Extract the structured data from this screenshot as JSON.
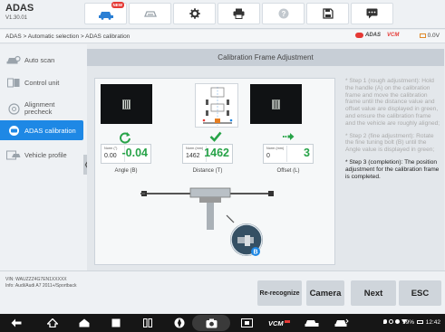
{
  "app": {
    "title": "ADAS",
    "version": "V1.30.01"
  },
  "top_buttons": [
    {
      "name": "home-car-icon",
      "badge": "NEW"
    },
    {
      "name": "vehicle-tools-icon"
    },
    {
      "name": "settings-gear-icon"
    },
    {
      "name": "printer-icon"
    },
    {
      "name": "help-icon"
    },
    {
      "name": "save-icon"
    },
    {
      "name": "chat-icon"
    }
  ],
  "breadcrumb": "ADAS > Automatic selection > ADAS calibration",
  "brand_logos": [
    "ADAS",
    "VCM"
  ],
  "voltage": "0.0V",
  "sidebar": {
    "items": [
      {
        "label": "Auto scan",
        "icon": "car-search-icon"
      },
      {
        "label": "Control unit",
        "icon": "control-unit-icon"
      },
      {
        "label": "Alignment precheck",
        "icon": "wheel-icon"
      },
      {
        "label": "ADAS calibration",
        "icon": "calibration-icon"
      },
      {
        "label": "Vehicle profile",
        "icon": "vehicle-profile-icon"
      }
    ],
    "active_index": 3,
    "collapse_glyph": "❮"
  },
  "panel": {
    "title": "Calibration Frame Adjustment"
  },
  "measurements": [
    {
      "norm_label": "Norm (°)",
      "norm_value": "0.00",
      "value": "-0.04",
      "caption": "Angle (B)",
      "status": "rotate-icon"
    },
    {
      "norm_label": "Norm (mm)",
      "norm_value": "1462",
      "value": "1462",
      "caption": "Distance (T)",
      "status": "check-icon"
    },
    {
      "norm_label": "Norm (mm)",
      "norm_value": "0",
      "value": "3",
      "caption": "Offset (L)",
      "status": "arrow-right-icon"
    }
  ],
  "rig_label": "B",
  "steps": [
    {
      "text": "* Step 1 (rough adjustment): Hold the handle (A) on the calibration frame and move the calibration frame until the distance value and offset value are displayed in green, and ensure the calibration frame and the vehicle are roughly aligned;",
      "current": false
    },
    {
      "text": "* Step 2 (fine adjustment): Rotate the fine tuning bolt (B) until the Angle value is displayed in green;",
      "current": false
    },
    {
      "text": "* Step 3 (completion): The position adjustment for the calibration frame is completed.",
      "current": true
    }
  ],
  "vehicle": {
    "vin": "VIN: WAUZZZ4G7EN1XXXXX",
    "info": "Info: Audi/Audi A7 2011+/Sportback"
  },
  "actions": {
    "rerecognize": "Re-recognize",
    "camera": "Camera",
    "next": "Next",
    "esc": "ESC"
  },
  "status_bar": {
    "battery": "99%",
    "time": "12:42"
  },
  "colors": {
    "accent": "#1e88e5",
    "ok_green": "#27a348",
    "new_badge": "#e53935"
  }
}
